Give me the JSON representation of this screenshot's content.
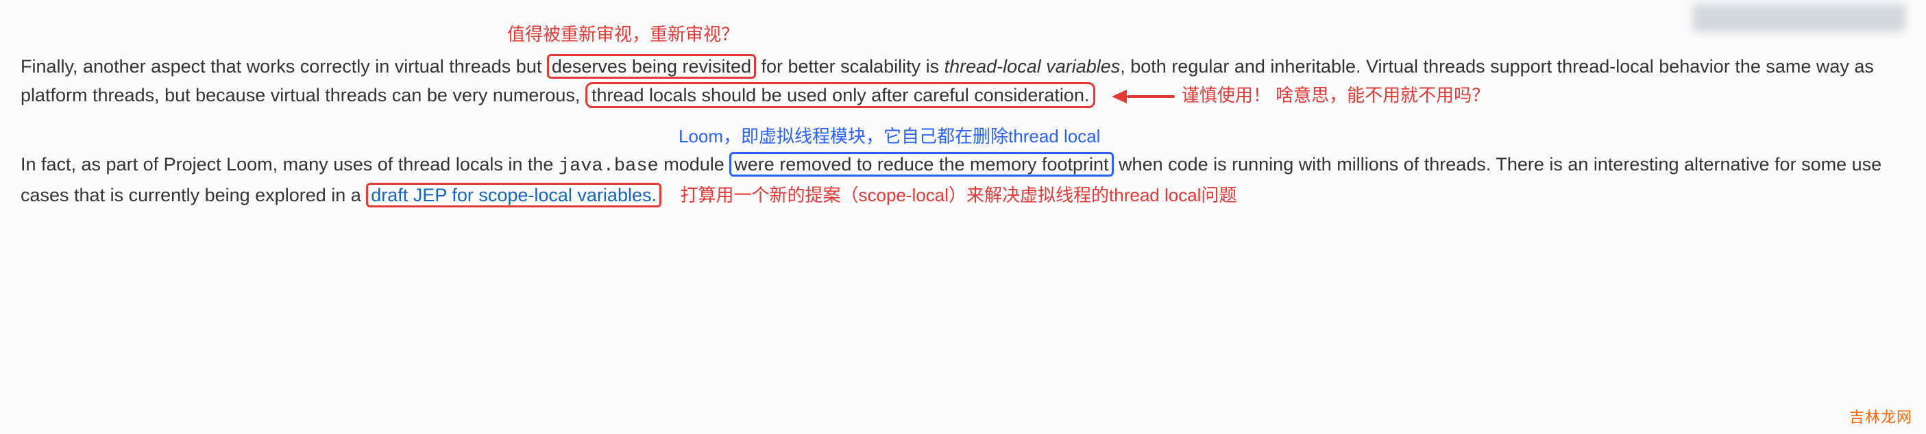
{
  "annotations": {
    "top_red": "值得被重新审视，重新审视？",
    "right_red": "谨慎使用！  啥意思，能不用就不用吗？",
    "right_blue": "Loom，即虚拟线程模块，它自己都在删除thread local",
    "bottom_red": "打算用一个新的提案（scope-local）来解决虚拟线程的thread local问题"
  },
  "para1": {
    "t1": "Finally, another aspect that works correctly in virtual threads but ",
    "boxed1": "deserves being revisited",
    "t2": " for better scalability is ",
    "italic1": "thread-local variables",
    "t3": ", both regular and inheritable. Virtual threads support thread-local behavior the same way as platform threads, but because virtual threads can be very numerous, ",
    "boxed2": "thread locals should be used only after careful consideration."
  },
  "para2": {
    "t1": "In fact, as part of Project Loom, many uses of thread locals in the ",
    "mono1": "java.base",
    "t2": " module ",
    "boxedblue": "were removed to reduce the memory footprint",
    "t3": " when code is running with millions of threads. There is an interesting alternative for some use cases that is currently being explored in a ",
    "link1": "draft JEP for scope-local variables.",
    "blankafterbox": " "
  },
  "watermark": "吉林龙网"
}
